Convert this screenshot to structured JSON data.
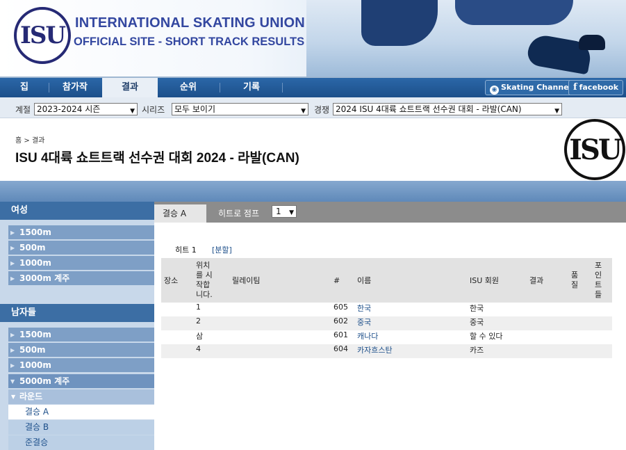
{
  "header": {
    "org_line1": "INTERNATIONAL SKATING UNION",
    "org_line2": "OFFICIAL SITE - SHORT TRACK RESULTS",
    "logo_text": "ISU"
  },
  "nav": {
    "items": [
      "집",
      "참가작",
      "결과",
      "순위",
      "기록"
    ],
    "active": "결과",
    "skating_channel": "Skating Channel",
    "facebook": "facebook"
  },
  "filters": {
    "season_label": "계절",
    "season_value": "2023-2024 시즌",
    "series_label": "시리즈",
    "series_value": "모두 보이기",
    "competition_label": "경쟁",
    "competition_value": "2024 ISU 4대륙 쇼트트랙 선수권 대회 - 라발(CAN)"
  },
  "breadcrumb": {
    "home": "홈",
    "sep": ">",
    "current": "결과"
  },
  "page_title": "ISU 4대륙 쇼트트랙 선수권 대회 2024 - 라발(CAN)",
  "sidebar": {
    "women_heading": "여성",
    "women_items": [
      "1500m",
      "500m",
      "1000m",
      "3000m 계주"
    ],
    "men_heading": "남자들",
    "men_items": [
      "1500m",
      "500m",
      "1000m",
      "5000m 계주"
    ],
    "round_label": "라운드",
    "rounds": [
      "결승 A",
      "결승 B",
      "준결승"
    ]
  },
  "tabs": {
    "final_a": "결승 A",
    "heat_jump": "히트로 점프",
    "heat_select_value": "1"
  },
  "heat": {
    "label": "히트 1",
    "split_link": "[분할]"
  },
  "table": {
    "headers": {
      "place": "장소",
      "start_pos": "위치를 시작합니다.",
      "relay_team": "릴레이팀",
      "number": "#",
      "name": "이름",
      "isu_member": "ISU 회원",
      "result": "결과",
      "quality": "품질",
      "points": "포인트들"
    },
    "rows": [
      {
        "place": "",
        "start": "1",
        "team": "",
        "num": "605",
        "name": "한국",
        "member": "한국",
        "result": "",
        "quality": "",
        "points": ""
      },
      {
        "place": "",
        "start": "2",
        "team": "",
        "num": "602",
        "name": "중국",
        "member": "중국",
        "result": "",
        "quality": "",
        "points": ""
      },
      {
        "place": "",
        "start": "삼",
        "team": "",
        "num": "601",
        "name": "캐나다",
        "member": "할 수 있다",
        "result": "",
        "quality": "",
        "points": ""
      },
      {
        "place": "",
        "start": "4",
        "team": "",
        "num": "604",
        "name": "카자흐스탄",
        "member": "카즈",
        "result": "",
        "quality": "",
        "points": ""
      }
    ]
  },
  "colors": {
    "nav_blue": "#1c4f8a",
    "sidebar_head": "#3c6ea4",
    "link": "#1d4f8a",
    "brand": "#3347a0"
  }
}
